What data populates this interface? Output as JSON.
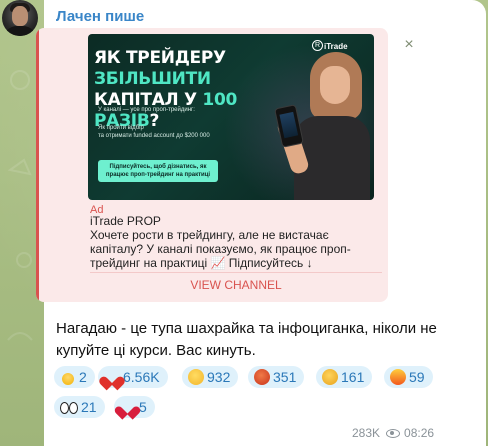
{
  "channel": {
    "author": "Лачен пише"
  },
  "ad": {
    "banner": {
      "headline_part1": "Як трейдеру ",
      "headline_accent1": "збільшити",
      "headline_part2": " капітал у ",
      "headline_accent2": "100 разів",
      "headline_end": "?",
      "brand": "iTrade",
      "line1": "У каналі — усе про проп-трейдинг:",
      "line2": "Як пройти відбір\nта отримати funded account до $200 000",
      "cta": "Підписуйтесь, щоб дізнатись, як працює проп-трейдинг на практиці"
    },
    "label": "Ad",
    "name": "iTrade PROP",
    "text": "Хочете рости в трейдингу, але не вистачає капіталу? У каналі показуємо, як працює проп-трейдинг на практиці 📈 Підписуйтесь ↓",
    "button": "VIEW CHANNEL",
    "close_icon": "close-icon"
  },
  "message": {
    "text": "Нагадаю - це тупа шахрайка та інфоциганка, ніколи не купуйте ці курси. Вас кинуть."
  },
  "reactions": [
    {
      "icon": "star-icon",
      "count": "2"
    },
    {
      "icon": "heart-icon",
      "count": "6.56K"
    },
    {
      "icon": "grin-icon",
      "count": "932"
    },
    {
      "icon": "angry-icon",
      "count": "351"
    },
    {
      "icon": "point-icon",
      "count": "161"
    },
    {
      "icon": "fire-icon",
      "count": "59"
    },
    {
      "icon": "eyes-icon",
      "count": "21"
    },
    {
      "icon": "broken-heart-icon",
      "count": "5"
    }
  ],
  "meta": {
    "views": "283K",
    "time": "08:26"
  }
}
